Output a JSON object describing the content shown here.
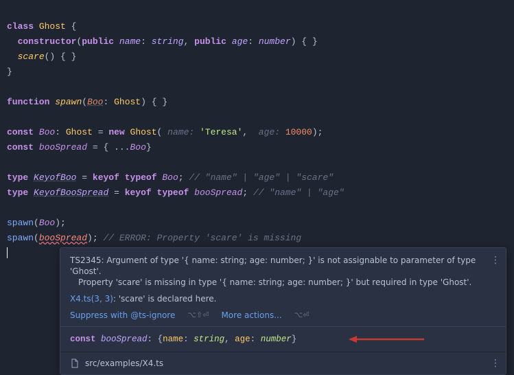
{
  "code": {
    "class_kw": "class",
    "class_name": "Ghost",
    "open_brace": " {",
    "ctor_kw": "constructor",
    "public1": "public",
    "name_prop": "name",
    "colon": ":",
    "string_t": "string",
    "comma": ",",
    "public2": "public",
    "age_prop": "age",
    "number_t": "number",
    "ctor_tail": ") { }",
    "scare_fn": "scare",
    "scare_tail": "() { }",
    "close_brace": "}",
    "fn_kw": "function",
    "fn_name": "spawn",
    "param_boo": "Boo",
    "ghost_t": "Ghost",
    "fn_tail": ") { }",
    "const_kw": "const",
    "boo_ident": "Boo",
    "eq": "=",
    "new_kw": "new",
    "hint_name": " name: ",
    "teresa": "'Teresa'",
    "hint_age": "  age: ",
    "ten_k": "10000",
    "paren_sc": ");",
    "boospread_ident": "booSpread",
    "spread_open": "= { ...",
    "spread_src": "Boo",
    "spread_close": "}",
    "type_kw": "type",
    "keyofBoo": "KeyofBoo",
    "keyof_kw": "keyof",
    "typeof_kw": "typeof",
    "semi": ";",
    "comment1": "// \"name\" | \"age\" | \"scare\"",
    "keyofBooSpread": "KeyofBooSpread",
    "comment2": "// \"name\" | \"age\"",
    "spawn_call": "spawn",
    "boo_arg": "Boo",
    "boospread_arg": "booSpread",
    "err_comment": "// ERROR: Property 'scare' is missing"
  },
  "popup": {
    "err_code": "TS2345: ",
    "err_line1": "Argument of type '{ name: string; age: number; }' is not assignable to parameter of type 'Ghost'.",
    "err_line2": "Property 'scare' is missing in type '{ name: string; age: number; }' but required in type 'Ghost'.",
    "src_link": "X4.ts(3, 3)",
    "src_tail": ": 'scare' is declared here.",
    "suppress": "Suppress with @ts-ignore",
    "more": "More actions...",
    "kbd1": "⌥⇧⏎",
    "kbd2": "⌥⏎",
    "sig_const": "const ",
    "sig_id": "booSpread",
    "sig_colon": ": ",
    "sig_open": "{",
    "sig_name": "name",
    "sig_string": "string",
    "sig_age": "age",
    "sig_number": "number",
    "sig_close": "}",
    "file": "src/examples/X4.ts"
  },
  "icons": {
    "more": "⋮",
    "file": "📄"
  },
  "colors": {
    "arrow": "#c63a33"
  }
}
